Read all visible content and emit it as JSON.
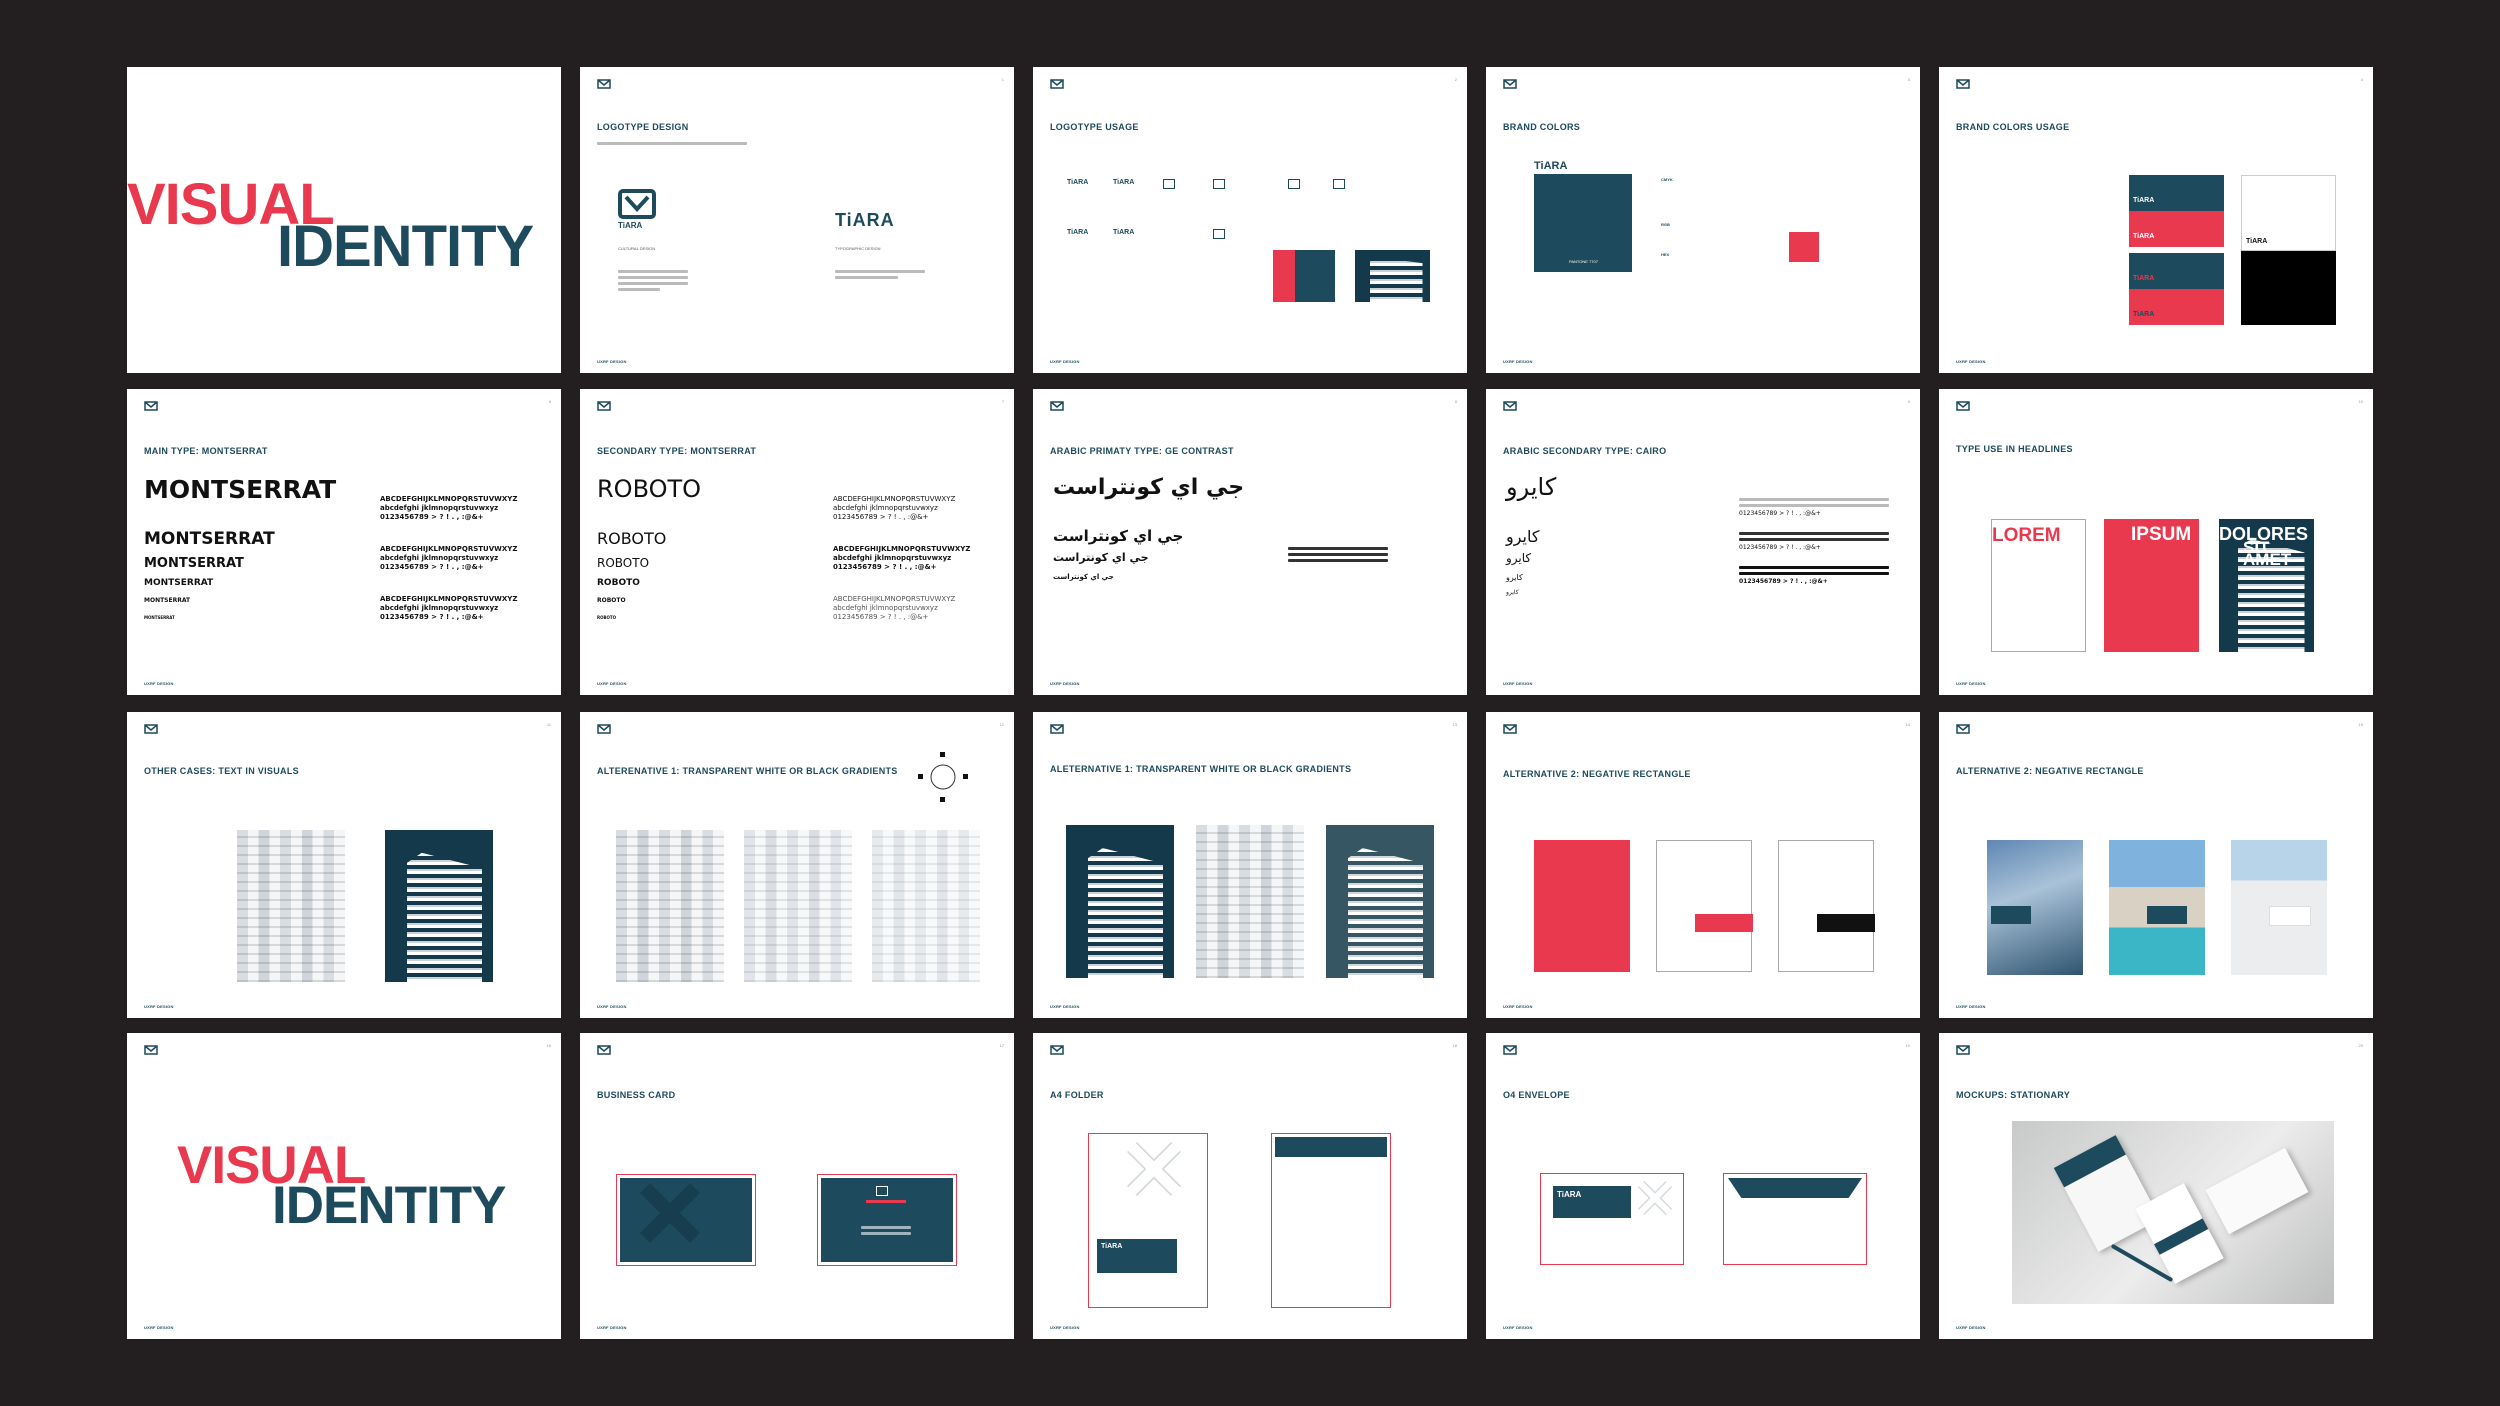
{
  "brand": "TiARA",
  "footer": "UXRF DESIGN",
  "colors": {
    "teal": "#1d4a5c",
    "red": "#e8394f",
    "black": "#111111"
  },
  "slides": {
    "s1": {
      "line1": "VISUAL",
      "line2": "IDENTITY"
    },
    "s2": {
      "title": "LOGOTYPE DESIGN",
      "logo_word": "TiARA",
      "caption1": "CULTURAL DESIGN",
      "caption2": "TYPOGRAPHIC DESIGN"
    },
    "s3": {
      "title": "LOGOTYPE USAGE",
      "variants": [
        "TiARA",
        "TiARA",
        "TiARA",
        "TiARA"
      ]
    },
    "s4": {
      "title": "BRAND COLORS",
      "logo_word": "TiARA",
      "pantone": "PANTONE 7707",
      "cmyk": "CMYK",
      "rgb": "RGB",
      "hex": "HEX"
    },
    "s5": {
      "title": "BRAND COLORS USAGE",
      "tiles": [
        "TiARA",
        "TiARA",
        "TiARA",
        "TiARA",
        "TiARA"
      ]
    },
    "s6": {
      "title": "MAIN TYPE: MONTSERRAT",
      "big": "MONTSERRAT",
      "sizes": [
        "MONTSERRAT",
        "MONTSERRAT",
        "MONTSERRAT",
        "MONTSERRAT",
        "MONTSERRAT"
      ],
      "upper": "ABCDEFGHIJKLMNOPQRSTUVWXYZ",
      "lower": "abcdefghi jklmnopqrstuvwxyz",
      "digits": "0123456789 > ? ! . , :@&+"
    },
    "s7": {
      "title": "SECONDARY TYPE: MONTSERRAT",
      "big": "ROBOTO",
      "sizes": [
        "ROBOTO",
        "ROBOTO",
        "ROBOTO",
        "ROBOTO",
        "ROBOTO"
      ],
      "upper": "ABCDEFGHIJKLMNOPQRSTUVWXYZ",
      "lower": "abcdefghi jklmnopqrstuvwxyz",
      "digits": "0123456789 > ? ! . , :@&+"
    },
    "s8": {
      "title": "ARABIC PRIMATY TYPE: GE CONTRAST",
      "big": "جي اي كونتراست",
      "sizes": [
        "جي اي كونتراست",
        "جي اي كونتراست",
        "جي اي كونتراست"
      ]
    },
    "s9": {
      "title": "ARABIC SECONDARY TYPE: CAIRO",
      "big": "كايرو",
      "sizes": [
        "كايرو",
        "كايرو",
        "كايرو",
        "كايرو"
      ],
      "digits": "0123456789 > ? ! . , :@&+"
    },
    "s10": {
      "title": "TYPE USE IN HEADLINES",
      "w1": "LOREM",
      "w2": "IPSUM",
      "w3": "DOLORES",
      "w4": "SIT",
      "w5": "AMET"
    },
    "s11": {
      "title": "OTHER CASES: TEXT IN VISUALS"
    },
    "s12": {
      "title": "ALTERENATIVE 1: TRANSPARENT WHITE OR BLACK GRADIENTS"
    },
    "s13": {
      "title": "ALETERNATIVE 1: TRANSPARENT WHITE OR BLACK GRADIENTS"
    },
    "s14": {
      "title": "ALTERNATIVE 2: NEGATIVE RECTANGLE"
    },
    "s15": {
      "title": "ALTERNATIVE 2: NEGATIVE RECTANGLE"
    },
    "s16": {
      "line1": "VISUAL",
      "line2": "IDENTITY"
    },
    "s17": {
      "title": "BUSINESS CARD"
    },
    "s18": {
      "title": "A4 FOLDER",
      "logo_word": "TiARA"
    },
    "s19": {
      "title": "O4 ENVELOPE",
      "logo_word": "TiARA"
    },
    "s20": {
      "title": "MOCKUPS: STATIONARY"
    }
  }
}
